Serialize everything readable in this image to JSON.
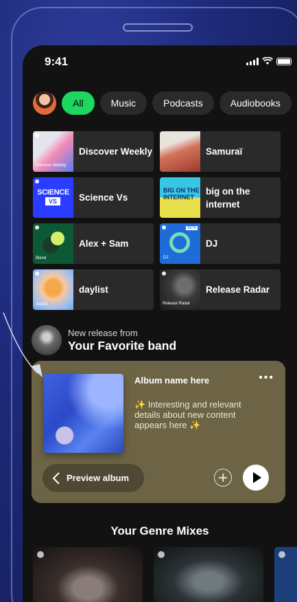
{
  "status": {
    "time": "9:41"
  },
  "filters": [
    "All",
    "Music",
    "Podcasts",
    "Audiobooks"
  ],
  "tiles": [
    {
      "label": "Discover Weekly",
      "thumb_text": "Discover Weekly"
    },
    {
      "label": "Samuraï"
    },
    {
      "label": "Science Vs",
      "thumb_text": "SCIENCE VS"
    },
    {
      "label": "big on the internet",
      "thumb_text": "BIG ON THE INTERNET"
    },
    {
      "label": "Alex + Sam",
      "thumb_text": "Blend"
    },
    {
      "label": "DJ",
      "thumb_text": "DJ",
      "badge": "BETA"
    },
    {
      "label": "daylist",
      "thumb_text": "daylist"
    },
    {
      "label": "Release Radar",
      "thumb_text": "Release Radar"
    }
  ],
  "new_release": {
    "subtitle": "New release from",
    "title": "Your Favorite band"
  },
  "card": {
    "album_name": "Album name here",
    "description": "✨ Interesting and relevant details about new content appears here ✨",
    "preview_label": "Preview album",
    "background_color": "#6d6445"
  },
  "genre_section": {
    "title": "Your Genre Mixes"
  },
  "colors": {
    "accent": "#1ed760",
    "background": "#121212"
  }
}
